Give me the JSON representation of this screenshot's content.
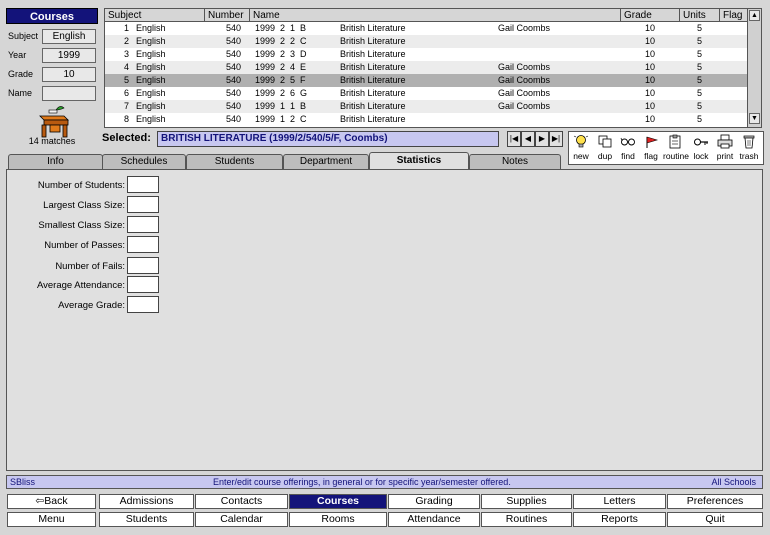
{
  "left_panel": {
    "title": "Courses",
    "filters": [
      {
        "label": "Subject",
        "value": "English"
      },
      {
        "label": "Year",
        "value": "1999"
      },
      {
        "label": "Grade",
        "value": "10"
      },
      {
        "label": "Name",
        "value": ""
      }
    ],
    "matches": "14 matches"
  },
  "table": {
    "headers": [
      "Subject",
      "Number",
      "Name",
      "Grade",
      "Units",
      "Flag"
    ],
    "rows": [
      {
        "idx": "1",
        "subject": "English",
        "number": "540",
        "code": "1999  2  1  B",
        "name": "British Literature",
        "teacher": "Gail Coombs",
        "grade": "10",
        "units": "5"
      },
      {
        "idx": "2",
        "subject": "English",
        "number": "540",
        "code": "1999  2  2  C",
        "name": "British Literature",
        "teacher": "",
        "grade": "10",
        "units": "5"
      },
      {
        "idx": "3",
        "subject": "English",
        "number": "540",
        "code": "1999  2  3  D",
        "name": "British Literature",
        "teacher": "",
        "grade": "10",
        "units": "5"
      },
      {
        "idx": "4",
        "subject": "English",
        "number": "540",
        "code": "1999  2  4  E",
        "name": "British Literature",
        "teacher": "Gail Coombs",
        "grade": "10",
        "units": "5"
      },
      {
        "idx": "5",
        "subject": "English",
        "number": "540",
        "code": "1999  2  5  F",
        "name": "British Literature",
        "teacher": "Gail Coombs",
        "grade": "10",
        "units": "5"
      },
      {
        "idx": "6",
        "subject": "English",
        "number": "540",
        "code": "1999  2  6  G",
        "name": "British Literature",
        "teacher": "Gail Coombs",
        "grade": "10",
        "units": "5"
      },
      {
        "idx": "7",
        "subject": "English",
        "number": "540",
        "code": "1999  1  1  B",
        "name": "British Literature",
        "teacher": "Gail Coombs",
        "grade": "10",
        "units": "5"
      },
      {
        "idx": "8",
        "subject": "English",
        "number": "540",
        "code": "1999  1  2  C",
        "name": "British Literature",
        "teacher": "",
        "grade": "10",
        "units": "5"
      }
    ]
  },
  "selected": {
    "label": "Selected:",
    "value": "BRITISH LITERATURE (1999/2/540/5/F, Coombs)"
  },
  "toolbar": {
    "new": "new",
    "dup": "dup",
    "find": "find",
    "flag": "flag",
    "routine": "routine",
    "lock": "lock",
    "print": "print",
    "trash": "trash"
  },
  "tabs": [
    "Info",
    "Schedules",
    "Students",
    "Department",
    "Statistics",
    "Notes"
  ],
  "active_tab": "Statistics",
  "stats": [
    {
      "label": "Number of Students:",
      "value": ""
    },
    {
      "label": "Largest Class Size:",
      "value": ""
    },
    {
      "label": "Smallest Class Size:",
      "value": ""
    },
    {
      "label": "Number of Passes:",
      "value": ""
    },
    {
      "label": "Number of Fails:",
      "value": ""
    },
    {
      "label": "Average Attendance:",
      "value": ""
    },
    {
      "label": "Average Grade:",
      "value": ""
    }
  ],
  "status": {
    "left": "SBliss",
    "center": "Enter/edit course offerings, in general or for specific year/semester offered.",
    "right": "All Schools"
  },
  "bottom_nav": {
    "row1": [
      "Back",
      "Admissions",
      "Contacts",
      "Courses",
      "Grading",
      "Supplies",
      "Letters",
      "Preferences"
    ],
    "row2": [
      "Menu",
      "Students",
      "Calendar",
      "Rooms",
      "Attendance",
      "Routines",
      "Reports",
      "Quit"
    ],
    "active": "Courses"
  },
  "colors": {
    "accent": "#13137a",
    "selection_bg": "#c7c7f0"
  }
}
